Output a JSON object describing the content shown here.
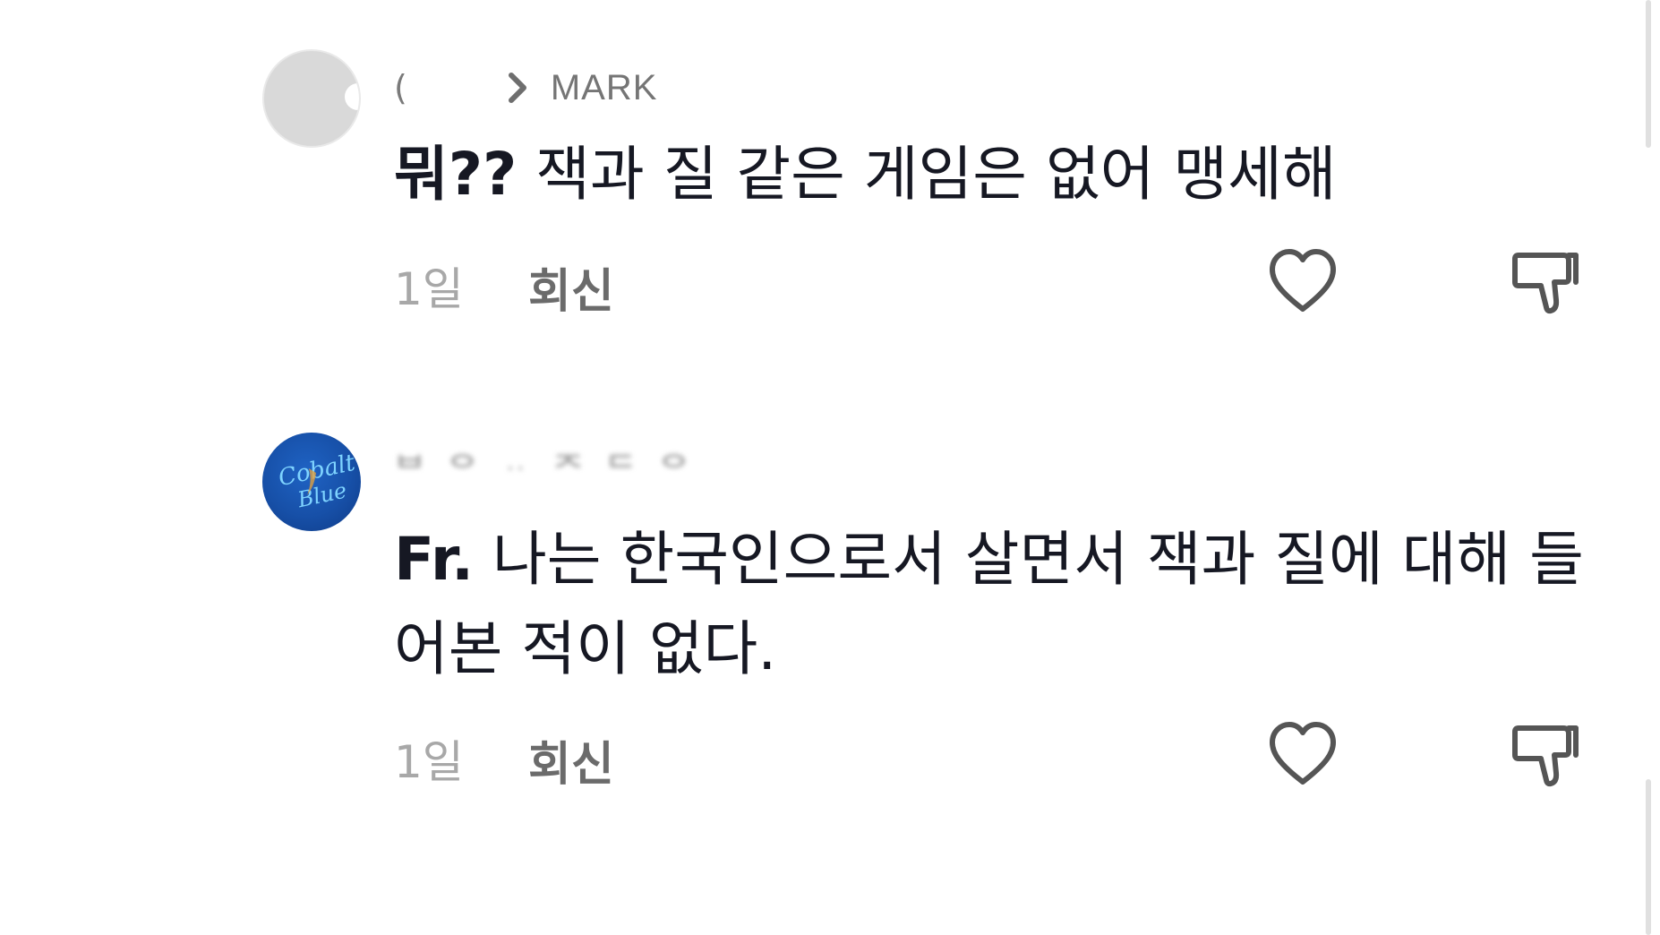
{
  "comments": [
    {
      "username": "(",
      "reply_to": "MARK",
      "text_bold": "뭐??",
      "text": " 잭과 질 같은 게임은 없어 맹세해",
      "time": "1일",
      "reply_label": "회신",
      "avatar": "gray-avatar"
    },
    {
      "username": "ᄇ ᄋ ᆢ ᄌ ᄃ ᄋ",
      "text_bold": "Fr.",
      "text": " 나는 한국인으로서 살면서 잭과 질에 대해 들어본 적이 없다.",
      "time": "1일",
      "reply_label": "회신",
      "avatar": "cobalt-blue-avatar",
      "avatar_text": "Cobalt Blue"
    }
  ],
  "icons": {
    "like": "heart-outline-icon",
    "dislike": "thumbs-down-outline-icon",
    "reply_chevron": "chevron-right-icon"
  },
  "colors": {
    "text_primary": "#161823",
    "text_secondary": "#a8a8a8",
    "reply_label": "#6b6b6b",
    "avatar_blue": "#1750a8"
  }
}
